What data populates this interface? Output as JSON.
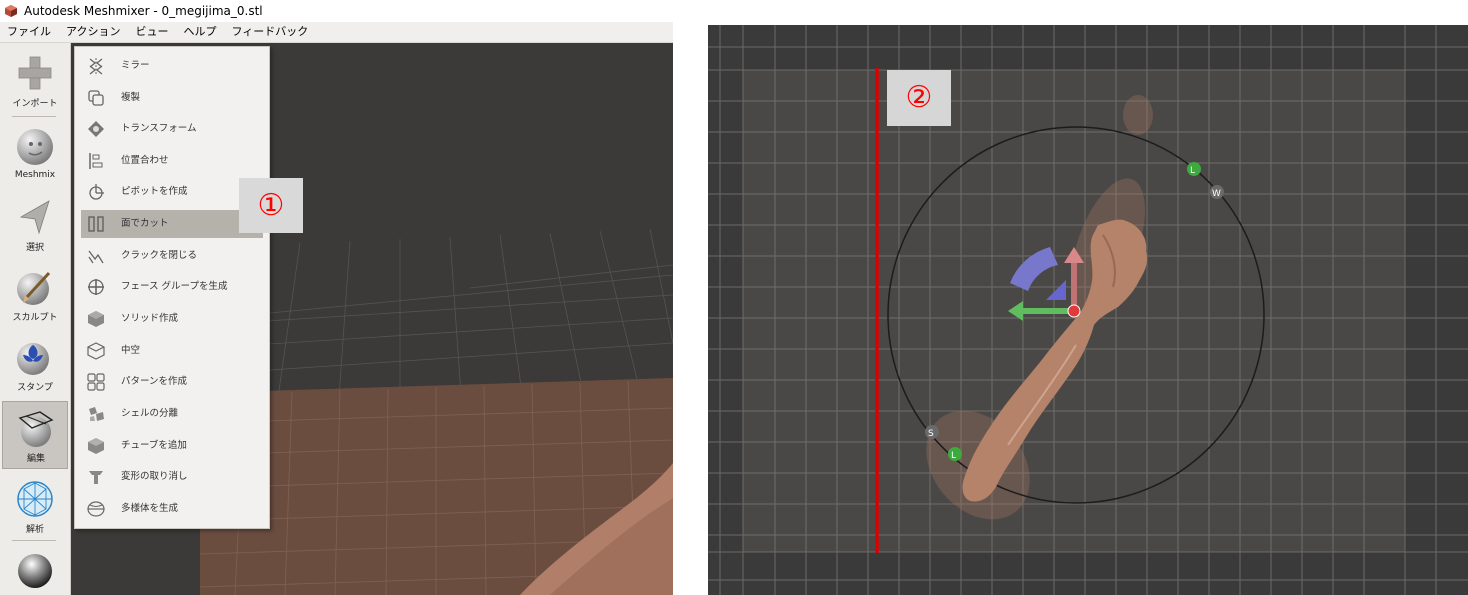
{
  "window": {
    "title": "Autodesk Meshmixer - 0_megijima_0.stl"
  },
  "menubar": {
    "items": [
      "ファイル",
      "アクション",
      "ビュー",
      "ヘルプ",
      "フィードバック"
    ]
  },
  "toolbar": {
    "items": [
      {
        "label": "インポート",
        "icon": "plus-icon"
      },
      {
        "label": "Meshmix",
        "icon": "meshmix-sphere-icon"
      },
      {
        "label": "選択",
        "icon": "select-arrow-icon"
      },
      {
        "label": "スカルプト",
        "icon": "sculpt-brush-icon"
      },
      {
        "label": "スタンプ",
        "icon": "stamp-icon"
      },
      {
        "label": "編集",
        "icon": "edit-sphere-icon",
        "active": true
      },
      {
        "label": "解析",
        "icon": "analysis-mesh-icon"
      }
    ]
  },
  "edit_menu": {
    "items": [
      {
        "label": "ミラー",
        "icon": "mirror-icon"
      },
      {
        "label": "複製",
        "icon": "duplicate-icon"
      },
      {
        "label": "トランスフォーム",
        "icon": "transform-icon"
      },
      {
        "label": "位置合わせ",
        "icon": "align-icon"
      },
      {
        "label": "ピボットを作成",
        "icon": "pivot-icon"
      },
      {
        "label": "面でカット",
        "icon": "plane-cut-icon",
        "highlighted": true
      },
      {
        "label": "クラックを閉じる",
        "icon": "close-cracks-icon"
      },
      {
        "label": "フェース グループを生成",
        "icon": "face-groups-icon"
      },
      {
        "label": "ソリッド作成",
        "icon": "make-solid-icon"
      },
      {
        "label": "中空",
        "icon": "hollow-icon"
      },
      {
        "label": "パターンを作成",
        "icon": "pattern-icon"
      },
      {
        "label": "シェルの分離",
        "icon": "separate-shells-icon"
      },
      {
        "label": "チューブを追加",
        "icon": "add-tube-icon"
      },
      {
        "label": "変形の取り消し",
        "icon": "discard-transform-icon"
      },
      {
        "label": "多様体を生成",
        "icon": "generate-manifold-icon"
      }
    ]
  },
  "annotations": {
    "marker1": "①",
    "marker2": "②"
  },
  "gizmo": {
    "labels": [
      "L",
      "W",
      "S",
      "L"
    ]
  },
  "colors": {
    "viewport_bg": "#3b3a38",
    "mesh": "#b5826a",
    "annotation_red": "#ff0000",
    "cut_plane_line": "#dd0000",
    "gizmo_x": "#5fbd5f",
    "gizmo_y": "#d47a7a",
    "gizmo_z": "#7b7bd8"
  }
}
